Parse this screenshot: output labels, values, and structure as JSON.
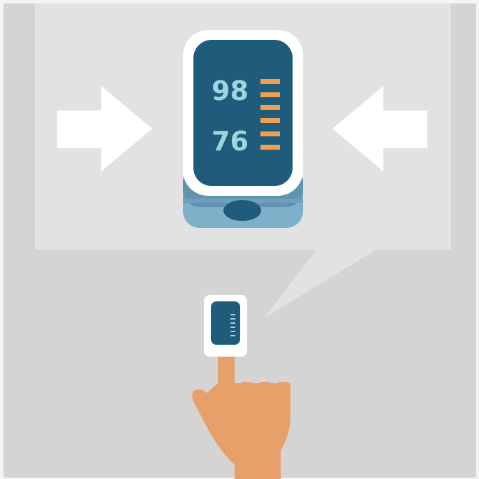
{
  "illustration": {
    "spo2_value": "98",
    "pulse_value": "76",
    "colors": {
      "outer_background": "#f4f4f4",
      "scene_background": "#d4d4d4",
      "callout_panel": "#e2e2e2",
      "device_frame": "#ffffff",
      "screen": "#1f5b7a",
      "reading_text": "#9ed6dd",
      "indicator_bars": "#f29f50",
      "device_base": "#7fb0c9",
      "device_base_dark": "#5f93b0",
      "button": "#1f5b7a",
      "skin": "#e7a06a",
      "arrow": "#ffffff"
    }
  }
}
